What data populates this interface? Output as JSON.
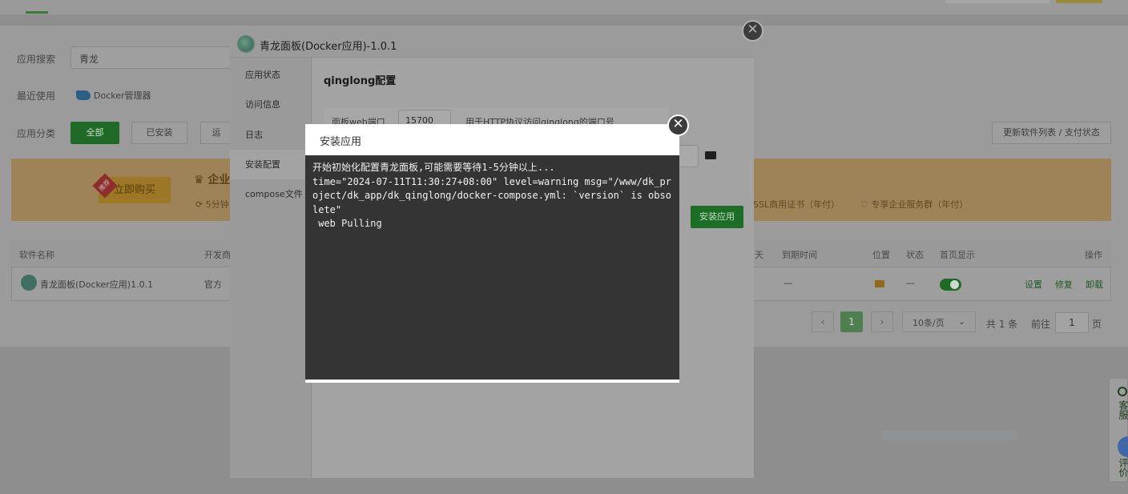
{
  "page": {
    "search_label": "应用搜索",
    "search_value": "青龙",
    "recent_label": "最近使用",
    "recent_app": "Docker管理器",
    "category_label": "应用分类",
    "categories": [
      "全部",
      "已安装",
      "运行"
    ],
    "update_button": "更新软件列表 / 支付状态"
  },
  "banner": {
    "buy_label": "立即购买",
    "hot_badge": "推荐",
    "title_fragment": "企业",
    "feature_left": "5分钟",
    "feature_ssl": "SSL商用证书（年付）",
    "feature_service": "专享企业服务群（年付）"
  },
  "table": {
    "headers": [
      "软件名称",
      "开发商",
      "天",
      "到期时间",
      "位置",
      "状态",
      "首页显示",
      "操作"
    ],
    "row": {
      "name": "青龙面板(Docker应用)1.0.1",
      "developer": "官方",
      "expire": "—",
      "status": "—",
      "ops": [
        "设置",
        "修复",
        "卸载"
      ]
    }
  },
  "pagination": {
    "prev": "‹",
    "current": "1",
    "next": "›",
    "per_page": "10条/页",
    "total": "共 1 条",
    "goto_label": "前往",
    "goto_value": "1",
    "page_suffix": "页"
  },
  "side_widget": {
    "service": "客服",
    "review": "评价"
  },
  "outer_modal": {
    "title": "青龙面板(Docker应用)-1.0.1",
    "close": "✕",
    "menu": [
      "应用状态",
      "访问信息",
      "日志",
      "安装配置",
      "compose文件"
    ],
    "active_menu": "安装配置",
    "heading": "qinglong配置",
    "port_label": "面板web端口",
    "port_value": "15700",
    "port_hint": "用于HTTP协议访问qinglong的端口号",
    "install_button": "安装应用"
  },
  "inner_modal": {
    "title": "安装应用",
    "close": "✕",
    "log_lines": [
      "开始初始化配置青龙面板,可能需要等待1-5分钟以上...",
      "time=\"2024-07-11T11:30:27+08:00\" level=warning msg=\"/www/dk_project/dk_app/dk_qinglong/docker-compose.yml: `version` is obsolete\"",
      " web Pulling"
    ]
  },
  "colors": {
    "accent_green": "#20a53a",
    "terminal_bg": "#333333",
    "overlay": "rgba(0,0,0,0.38)"
  }
}
